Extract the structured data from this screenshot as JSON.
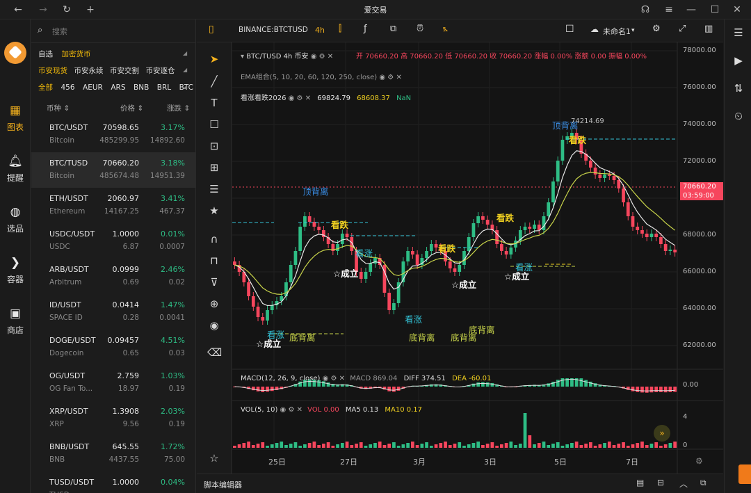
{
  "window": {
    "title": "爱交易"
  },
  "nav": {
    "items": [
      {
        "label": "图表",
        "icon": "chart-icon"
      },
      {
        "label": "提醒",
        "icon": "bell-icon"
      },
      {
        "label": "选品",
        "icon": "analytics-icon"
      },
      {
        "label": "容器",
        "icon": "container-icon"
      },
      {
        "label": "商店",
        "icon": "store-icon"
      }
    ]
  },
  "panel": {
    "search_placeholder": "搜索",
    "filter_row1": [
      "自选",
      "加密货币"
    ],
    "filter_row2": [
      "币安现货",
      "币安永续",
      "币安交割",
      "币安逐仓"
    ],
    "filter_row3": [
      "全部",
      "456",
      "AEUR",
      "ARS",
      "BNB",
      "BRL",
      "BTC"
    ],
    "columns": [
      "币种",
      "价格",
      "涨跌"
    ],
    "coins": [
      {
        "symbol": "BTC/USDT",
        "name": "Bitcoin",
        "price": "70598.65",
        "volume": "485299.95",
        "change": "3.17%",
        "amount": "14892.60"
      },
      {
        "symbol": "BTC/TUSD",
        "name": "Bitcoin",
        "price": "70660.20",
        "volume": "485674.48",
        "change": "3.18%",
        "amount": "14951.39"
      },
      {
        "symbol": "ETH/USDT",
        "name": "Ethereum",
        "price": "2060.97",
        "volume": "14167.25",
        "change": "3.41%",
        "amount": "467.37"
      },
      {
        "symbol": "USDC/USDT",
        "name": "USDC",
        "price": "1.0000",
        "volume": "6.87",
        "change": "0.01%",
        "amount": "0.0007"
      },
      {
        "symbol": "ARB/USDT",
        "name": "Arbitrum",
        "price": "0.0999",
        "volume": "0.69",
        "change": "2.46%",
        "amount": "0.02"
      },
      {
        "symbol": "ID/USDT",
        "name": "SPACE ID",
        "price": "0.0414",
        "volume": "0.28",
        "change": "1.47%",
        "amount": "0.0041"
      },
      {
        "symbol": "DOGE/USDT",
        "name": "Dogecoin",
        "price": "0.09457",
        "volume": "0.65",
        "change": "4.51%",
        "amount": "0.03"
      },
      {
        "symbol": "OG/USDT",
        "name": "OG Fan To...",
        "price": "2.759",
        "volume": "18.97",
        "change": "1.03%",
        "amount": "0.19"
      },
      {
        "symbol": "XRP/USDT",
        "name": "XRP",
        "price": "1.3908",
        "volume": "9.56",
        "change": "2.03%",
        "amount": "0.19"
      },
      {
        "symbol": "BNB/USDT",
        "name": "BNB",
        "price": "645.55",
        "volume": "4437.55",
        "change": "1.72%",
        "amount": "75.00"
      },
      {
        "symbol": "TUSD/USDT",
        "name": "TUSD",
        "price": "1.0000",
        "volume": "",
        "change": "0.04%",
        "amount": ""
      }
    ]
  },
  "chart_header": {
    "symbol": "BINANCE:BTCTUSD",
    "interval": "4h",
    "layout_name": "未命名1"
  },
  "legend": {
    "title": "BTC/TUSD 4h 币安",
    "ohlc": "开 70660.20 高 70660.20 低 70660.20 收 70660.20 涨幅 0.00% 涨额 0.00 振幅 0.00%",
    "ema": "EMA组合(5, 10, 20, 60, 120, 250, close)",
    "indicator_name": "看涨看跌2026",
    "indicator_v1": "69824.79",
    "indicator_v2": "68608.37",
    "indicator_v3": "NaN",
    "macd_name": "MACD(12, 26, 9, close)",
    "macd_v": "MACD 869.04",
    "macd_diff": "DIFF 374.51",
    "macd_dea": "DEA -60.01",
    "vol_name": "VOL(5, 10)",
    "vol_v": "VOL 0.00",
    "ma5": "MA5 0.13",
    "ma10": "MA10 0.17"
  },
  "price_axis": [
    "78000.00",
    "76000.00",
    "74000.00",
    "72000.00",
    "70000.00",
    "68000.00",
    "66000.00",
    "64000.00",
    "62000.00"
  ],
  "current_price": "70660.20",
  "countdown": "03:59:00",
  "macd_axis": "0.00",
  "vol_axis": [
    "4",
    "0"
  ],
  "date_axis": [
    "25日",
    "27日",
    "3月",
    "3日",
    "5日",
    "7日"
  ],
  "annotations": {
    "high": "74214.69",
    "labels": [
      "顶背离",
      "看跌",
      "看涨",
      "☆成立",
      "底背离",
      "顶背离"
    ]
  },
  "bottom": {
    "script_editor": "脚本编辑器"
  },
  "colors": {
    "up": "#2ebd85",
    "down": "#f6465d",
    "accent": "#f0b90b",
    "ema_white": "#e8e8e8",
    "ema_yellow": "#c8d44a"
  }
}
